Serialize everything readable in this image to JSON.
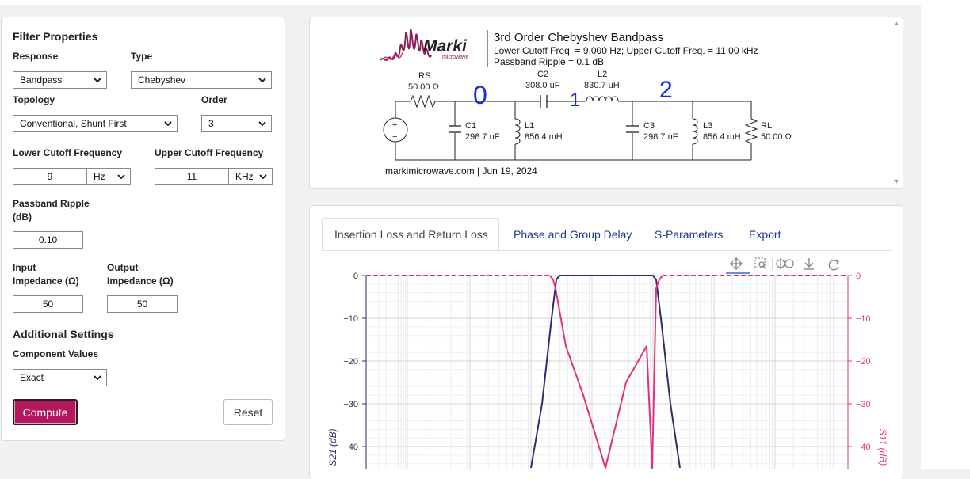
{
  "colors": {
    "accent": "#b3185f",
    "s21": "#2b2d6e",
    "s11": "#e0337f",
    "link": "#1b3b8a"
  },
  "filter_properties": {
    "title": "Filter Properties",
    "response_label": "Response",
    "response_value": "Bandpass",
    "type_label": "Type",
    "type_value": "Chebyshev",
    "topology_label": "Topology",
    "topology_value": "Conventional, Shunt First",
    "order_label": "Order",
    "order_value": "3",
    "lower_cutoff_label": "Lower Cutoff Frequency",
    "lower_cutoff_value": "9",
    "lower_cutoff_unit": "Hz",
    "upper_cutoff_label": "Upper Cutoff Frequency",
    "upper_cutoff_value": "11",
    "upper_cutoff_unit": "KHz",
    "ripple_label_1": "Passband Ripple",
    "ripple_label_2": "(dB)",
    "ripple_value": "0.10",
    "input_label_1": "Input",
    "input_label_2": "Impedance (Ω)",
    "input_value": "50",
    "output_label_1": "Output",
    "output_label_2": "Impedance (Ω)",
    "output_value": "50"
  },
  "additional": {
    "title": "Additional Settings",
    "component_values_label": "Component Values",
    "component_values_value": "Exact"
  },
  "buttons": {
    "compute": "Compute",
    "reset": "Reset"
  },
  "schematic": {
    "logo_text": "Marki",
    "logo_sub": "microwave",
    "title": "3rd Order Chebyshev Bandpass",
    "line1": "Lower Cutoff Freq. = 9.000 Hz; Upper Cutoff Freq. = 11.00 kHz",
    "line2": "Passband Ripple = 0.1 dB",
    "footer": "markimicrowave.com | Jun 19, 2024",
    "handwritten_0": "0",
    "handwritten_1": "1",
    "handwritten_2": "2",
    "components": {
      "rs_name": "RS",
      "rs_value": "50.00 Ω",
      "c2_name": "C2",
      "c2_value": "308.0 uF",
      "l2_name": "L2",
      "l2_value": "830.7 uH",
      "c1_name": "C1",
      "c1_value": "298.7 nF",
      "l1_name": "L1",
      "l1_value": "856.4 mH",
      "c3_name": "C3",
      "c3_value": "298.7 nF",
      "l3_name": "L3",
      "l3_value": "856.4 mH",
      "rl_name": "RL",
      "rl_value": "50.00 Ω",
      "source_plus": "+",
      "source_minus": "−"
    }
  },
  "tabs": [
    {
      "label": "Insertion Loss and Return Loss",
      "active": true
    },
    {
      "label": "Phase and Group Delay",
      "active": false
    },
    {
      "label": "S-Parameters",
      "active": false
    },
    {
      "label": "Export",
      "active": false
    }
  ],
  "toolbar_icons": [
    "pan-icon",
    "zoom-box-icon",
    "zoom-icon",
    "download-icon",
    "reset-icon"
  ],
  "chart_data": {
    "type": "line",
    "y_left_label": "S21 (dB)",
    "y_right_label": "S11 (dB)",
    "y_left_ticks": [
      "0",
      "−10",
      "−20",
      "−30",
      "−40"
    ],
    "y_right_ticks": [
      "0",
      "−10",
      "−20",
      "−30",
      "−40"
    ],
    "ylim": [
      -45,
      0
    ],
    "grid": true,
    "series": [
      {
        "name": "S21",
        "y": [
          -45,
          -30,
          -10,
          -1,
          0,
          0,
          0,
          0,
          0,
          -1,
          -10,
          -30,
          -45
        ]
      },
      {
        "name": "S11",
        "y": [
          0,
          -1,
          -3,
          -16.5,
          -28,
          -45,
          -25,
          -16.5,
          -45,
          -3,
          -1,
          0
        ]
      }
    ]
  }
}
